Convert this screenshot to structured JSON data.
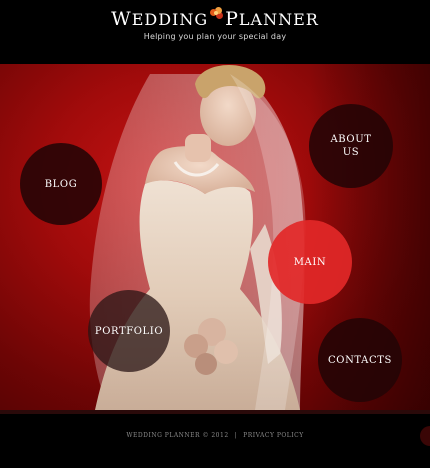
{
  "header": {
    "logo_word1_cap": "W",
    "logo_word1_rest": "EDDING",
    "logo_word2_cap": "P",
    "logo_word2_rest": "LANNER",
    "tagline": "Helping you plan your special day"
  },
  "nav": {
    "blog": "BLOG",
    "about_line1": "ABOUT",
    "about_line2": "US",
    "main": "MAIN",
    "portfolio": "PORTFOLIO",
    "contacts": "CONTACTS"
  },
  "footer": {
    "copyright": "WEDDING PLANNER © 2012",
    "separator": "|",
    "privacy": "PRIVACY POLICY"
  },
  "colors": {
    "background": "#000000",
    "stage_red": "#a10b0b",
    "active_circle": "#e22828",
    "dark_circle": "#230506"
  }
}
